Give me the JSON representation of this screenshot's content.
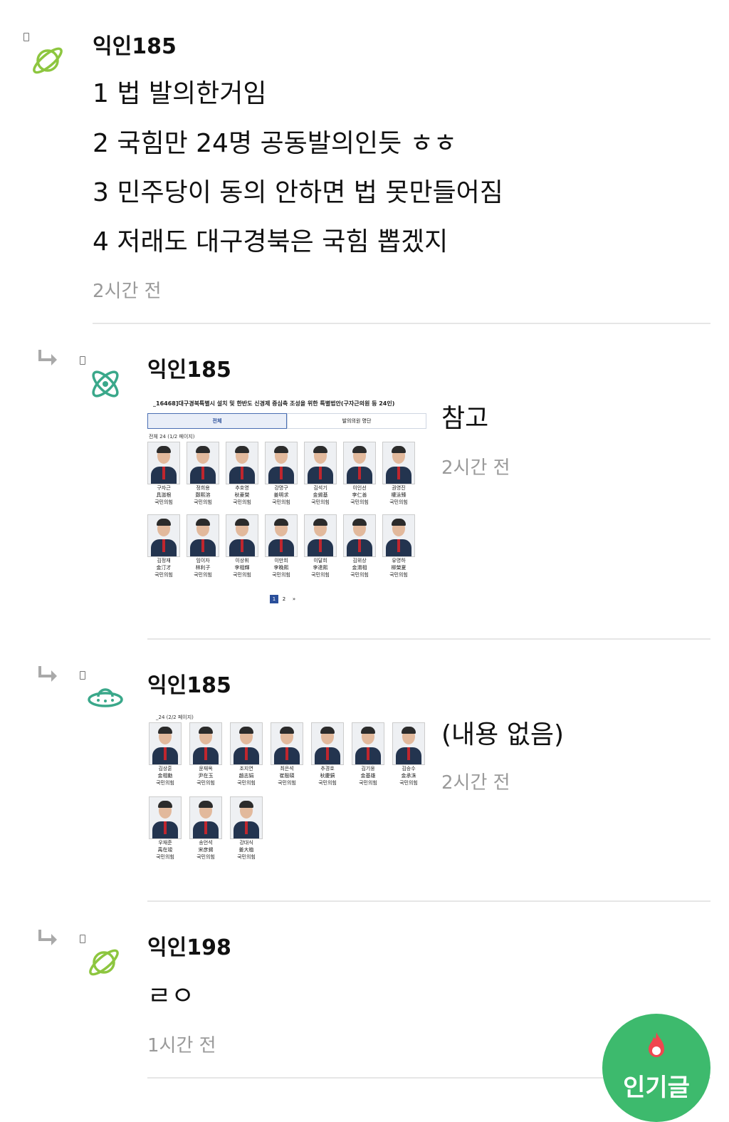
{
  "comments": [
    {
      "author": "익인185",
      "lines": [
        "1 법 발의한거임",
        "2 국힘만 24명 공동발의인듯 ㅎㅎ",
        "3 민주당이 동의 안하면 법 못만들어짐",
        "4 저래도 대구경북은 국힘 뽑겠지"
      ],
      "time": "2시간 전",
      "avatar_icon": "planet-icon"
    },
    {
      "author": "익인185",
      "text": "참고",
      "time": "2시간 전",
      "avatar_icon": "atom-icon",
      "image": {
        "title": "_16468]대구경북특별시 설치 및 한반도 신경제 중심축 조성을 위한 특별법안(구자근의원 등 24인)",
        "tabs": [
          "전체",
          "발의의원 명단"
        ],
        "count_label": "전체 24 (1/2 페이지)",
        "members": [
          {
            "name": "구자근",
            "hanja": "具滋根",
            "party": "국민의힘"
          },
          {
            "name": "정희용",
            "hanja": "鄭熙溶",
            "party": "국민의힘"
          },
          {
            "name": "추호영",
            "hanja": "秋豪榮",
            "party": "국민의힘"
          },
          {
            "name": "강명구",
            "hanja": "姜明求",
            "party": "국민의힘"
          },
          {
            "name": "김석기",
            "hanja": "金錫基",
            "party": "국민의힘"
          },
          {
            "name": "이인선",
            "hanja": "李仁善",
            "party": "국민의힘"
          },
          {
            "name": "권영진",
            "hanja": "權泳臻",
            "party": "국민의힘"
          },
          {
            "name": "김정재",
            "hanja": "金汀才",
            "party": "국민의힘"
          },
          {
            "name": "임이자",
            "hanja": "林利子",
            "party": "국민의힘"
          },
          {
            "name": "이상휘",
            "hanja": "李相輝",
            "party": "국민의힘"
          },
          {
            "name": "이만희",
            "hanja": "李晩熙",
            "party": "국민의힘"
          },
          {
            "name": "이달희",
            "hanja": "李達熙",
            "party": "국민의힘"
          },
          {
            "name": "김위상",
            "hanja": "金渭相",
            "party": "국민의힘"
          },
          {
            "name": "유영하",
            "hanja": "柳榮夏",
            "party": "국민의힘"
          }
        ],
        "pager": [
          "1",
          "2",
          "»"
        ]
      }
    },
    {
      "author": "익인185",
      "text": "(내용 없음)",
      "time": "2시간 전",
      "avatar_icon": "ufo-icon",
      "image": {
        "count_label": "_24 (2/2 페이지)",
        "members": [
          {
            "name": "김상훈",
            "hanja": "金相勳",
            "party": "국민의힘"
          },
          {
            "name": "윤재옥",
            "hanja": "尹在玉",
            "party": "국민의힘"
          },
          {
            "name": "조지연",
            "hanja": "趙志娟",
            "party": "국민의힘"
          },
          {
            "name": "최은석",
            "hanja": "崔殷碩",
            "party": "국민의힘"
          },
          {
            "name": "추경호",
            "hanja": "秋慶鎬",
            "party": "국민의힘"
          },
          {
            "name": "김기웅",
            "hanja": "金基雄",
            "party": "국민의힘"
          },
          {
            "name": "김승수",
            "hanja": "金承洙",
            "party": "국민의힘"
          },
          {
            "name": "우재준",
            "hanja": "禹在竣",
            "party": "국민의힘"
          },
          {
            "name": "송언석",
            "hanja": "宋彦錫",
            "party": "국민의힘"
          },
          {
            "name": "강대식",
            "hanja": "姜大植",
            "party": "국민의힘"
          }
        ]
      }
    },
    {
      "author": "익인198",
      "text": "ㄹㅇ",
      "time": "1시간 전",
      "avatar_icon": "planet-icon"
    }
  ],
  "fab": {
    "label": "인기글",
    "icon": "fire-icon",
    "color": "#3dba6d"
  },
  "colors": {
    "avatar_green": "#8dc63f",
    "avatar_teal": "#3aa88a",
    "muted": "#9a9a9a"
  }
}
